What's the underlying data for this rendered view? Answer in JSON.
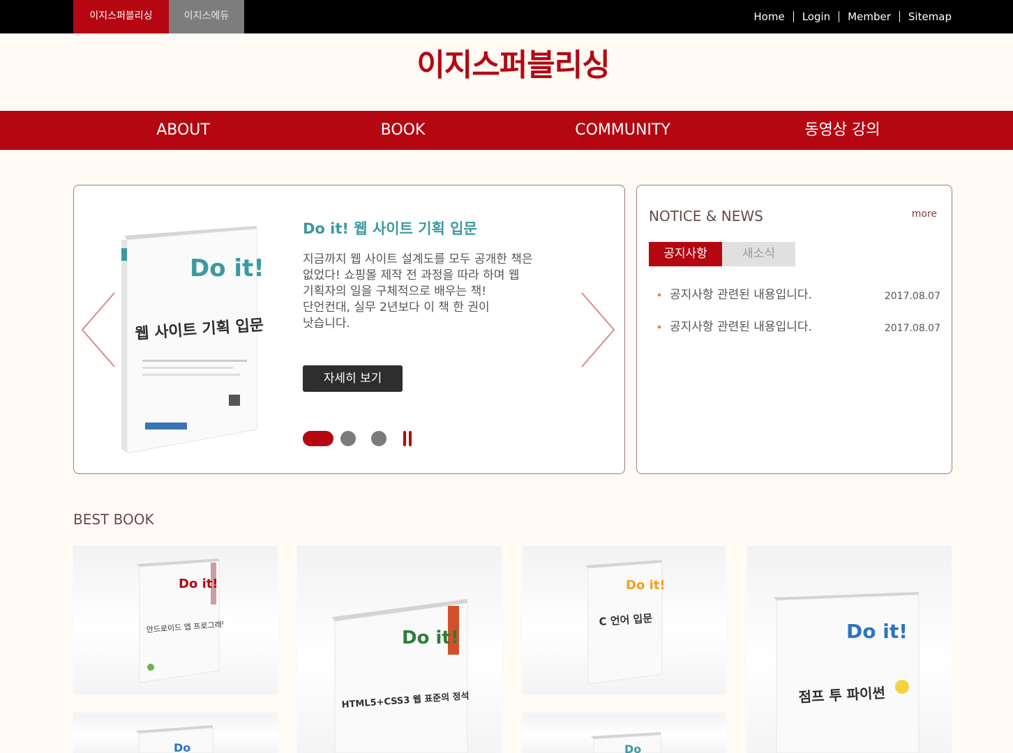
{
  "topbar": {
    "site_tabs": [
      "이지스퍼블리싱",
      "이지스에듀"
    ],
    "util_links": [
      "Home",
      "Login",
      "Member",
      "Sitemap"
    ]
  },
  "header": {
    "logo_text": "이지스퍼블리싱"
  },
  "nav": {
    "items": [
      "ABOUT",
      "BOOK",
      "COMMUNITY",
      "동영상 강의"
    ]
  },
  "slider": {
    "title": "Do it! 웹 사이트 기획 입문",
    "description": "지금까지 웹 사이트 설계도를 모두 공개한 책은 없었다! 쇼핑몰 제작 전 과정을 따라 하며 웹 기획자의 일을 구체적으로 배우는 책! 단언컨대, 실무 2년보다 이 책 한 권이 낫습니다.",
    "button_label": "자세히 보기",
    "cover": {
      "series": "Do it!",
      "title": "웹 사이트 기획 입문",
      "spine": "웹 사이트 기획 입문"
    },
    "active_slide": 1,
    "slide_count": 3
  },
  "notice": {
    "title": "NOTICE & NEWS",
    "more_label": "more",
    "tabs": [
      "공지사항",
      "새소식"
    ],
    "items": [
      {
        "text": "공지사항 관련된 내용입니다.",
        "date": "2017.08.07"
      },
      {
        "text": "공지사항 관련된 내용입니다.",
        "date": "2017.08.07"
      }
    ]
  },
  "best_book": {
    "title": "BEST BOOK",
    "books": [
      {
        "series": "Do it!",
        "title": "안드로이드 앱 프로그래밍"
      },
      {
        "series": "Do it!",
        "title": "HTML5+CSS3 웹 표준의 정석"
      },
      {
        "series": "Do it!",
        "title": "C 언어 입문"
      },
      {
        "series": "Do it!",
        "title": "점프 투 파이썬"
      },
      {
        "series": "Do",
        "title": ""
      },
      {
        "series": "Do",
        "title": ""
      }
    ]
  },
  "colors": {
    "brand_red": "#b50712",
    "teal": "#3a9aa0",
    "topbar": "#000000",
    "background": "#fffbf4"
  }
}
